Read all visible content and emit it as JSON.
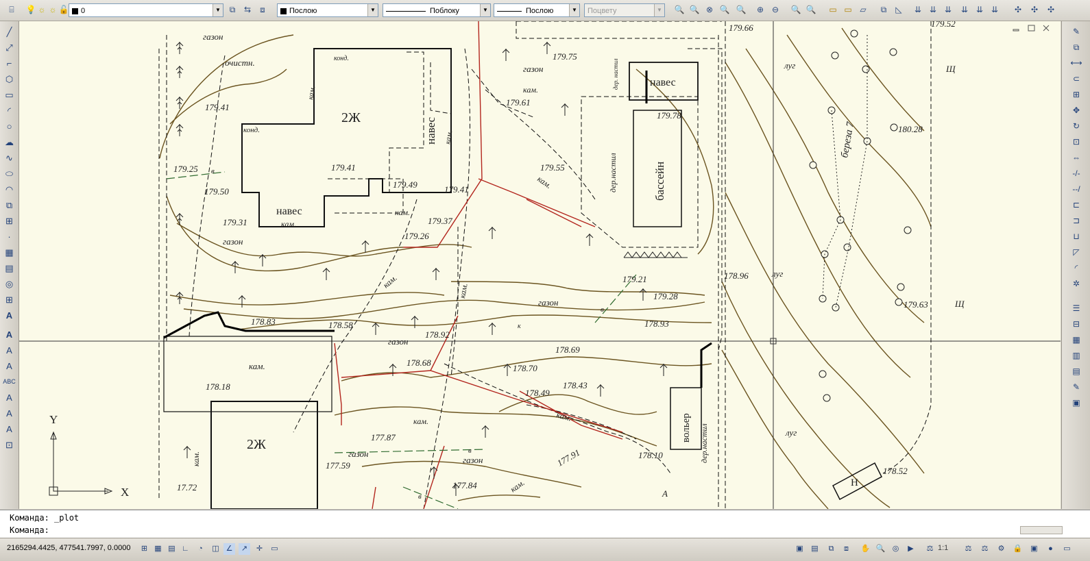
{
  "toolbar": {
    "layer_value": "0",
    "color_value": "Послою",
    "linetype_value": "Поблоку",
    "lineweight_value": "Послою",
    "plotstyle_value": "Поцвету"
  },
  "command": {
    "history_prompt": "Команда:",
    "history_value": "_plot",
    "current_prompt": "Команда:",
    "current_value": ""
  },
  "status": {
    "coordinates": "2165294.4425, 477541.7997, 0.0000",
    "scale": "1:1"
  },
  "ucs": {
    "x_label": "X",
    "y_label": "Y"
  },
  "drawing_labels": {
    "gazon1": "газон",
    "ochistn": "очистн.",
    "kond1": "конд.",
    "kam1": "кам.",
    "zh1": "2Ж",
    "naves1": "навес",
    "e17941a": "179.41",
    "konda": "конд.",
    "e17925": "179.25",
    "v1": "в",
    "e17941b": "179.41",
    "e17949": "179.49",
    "e17950": "179.50",
    "naves2": "навес",
    "e17931": "179.31",
    "kam2": "кам.",
    "gazon2": "газон",
    "kam3": "кам.",
    "e17937": "179.37",
    "e17926": "179.26",
    "e17941c": "179.41",
    "kam4": "кам.",
    "gazon3": "газон",
    "e17975": "179.75",
    "e17966": "179.66",
    "e17961": "179.61",
    "kam5": "кам.",
    "naves3": "навес",
    "der_nastil1": "дер.настил",
    "e17978": "179.78",
    "bassein": "бассейн",
    "e17955": "179.55",
    "kam6": "кам.",
    "kam7": "кам.",
    "e17921": "179.21",
    "e17928": "179.28",
    "gazon4": "газон",
    "e17883": "178.83",
    "e17858": "178.58",
    "e17892": "178.92",
    "gazon5": "газон",
    "e17893": "178.93",
    "kam8": "кам.",
    "e17818": "178.18",
    "e17868": "178.68",
    "e17869": "178.69",
    "e17870": "178.70",
    "e17843": "178.43",
    "e17849": "178.49",
    "zh2": "2Ж",
    "kam9": "кам.",
    "kam10": "кам.",
    "kam11": "кам.",
    "e17787": "177.87",
    "gazon6": "газон",
    "v2": "в",
    "gazon7": "газон",
    "e17759": "177.59",
    "e17784": "177.84",
    "e17791": "177.91",
    "kam12": "кам.",
    "e17772": "17.72",
    "volier": "вольер",
    "der_nastil2": "дер.настил",
    "e17810": "178.10",
    "a": "А",
    "lug1": "луг",
    "bereza": "береза 7",
    "e18028": "180.28",
    "lug2": "луг",
    "e17896": "178.96",
    "e17963": "179.63",
    "lug3": "луг",
    "sh1": "Щ",
    "sh2": "Щ",
    "n": "Н",
    "e17852": "178.52",
    "e17952": "179.52",
    "der_nastil3": "дер. настил",
    "v3": "в",
    "v4": "в",
    "k1": "к"
  }
}
